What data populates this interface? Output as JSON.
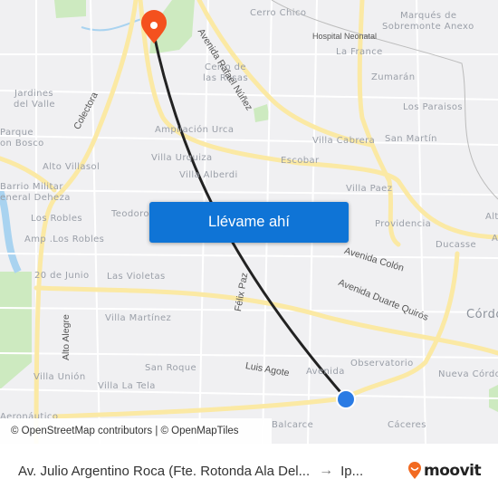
{
  "map": {
    "labels": {
      "cerro_chico": "Cerro Chico",
      "marques": "Marqués de",
      "sobremonte": "Sobremonte Anexo",
      "hospital": "Hospital Neonatal",
      "la_france": "La France",
      "zumaran": "Zumarán",
      "los_paraisos": "Los Paraisos",
      "san_martin": "San Martín",
      "villa_cabrera": "Villa Cabrera",
      "escobar": "Escobar",
      "villa_paez": "Villa Paez",
      "providencia": "Providencia",
      "ducasse": "Ducasse",
      "alta": "Alta",
      "a_partial": "A",
      "cordoba": "Córdo",
      "nueva_cordoba": "Nueva Córdo",
      "observatorio": "Observatorio",
      "avenida": "Avenida",
      "caceres": "Cáceres",
      "balcarce": "Balcarce",
      "cerro_rosas_1": "Cerro de",
      "cerro_rosas_2": "las Rosas",
      "ampliacion_urca": "Ampliación Urca",
      "villa_urquiza": "Villa Urquiza",
      "villa_alberdi": "Villa Alberdi",
      "jardines_1": "Jardines",
      "jardines_2": "del Valle",
      "parque_1": "Parque",
      "parque_2": "on Bosco",
      "alto_villasol": "Alto Villasol",
      "barrio_militar": "Barrio Militar",
      "general_deheza": "eneral Deheza",
      "los_robles": "Los Robles",
      "amp_los_robles": "Amp .Los Robles",
      "teodoro": "Teodoro",
      "veinte_junio": "20 de Junio",
      "las_violetas": "Las Violetas",
      "villa_martinez": "Villa Martínez",
      "villa_union": "Villa Unión",
      "villa_la_tela": "Villa La Tela",
      "san_roque": "San Roque",
      "aeronautico": "Aeronáutico"
    },
    "streets": {
      "rafael_nunez": "Avenida Rafael Núñez",
      "colectora": "Colectora",
      "felix_paz": "Félix Paz",
      "avenida_colon": "Avenida Colón",
      "duarte_quiros": "Avenida Duarte Quirós",
      "alto_alegre": "Alto Alegre",
      "luis_agote": "Luis Agote"
    },
    "destination_pin_color": "#f4511e",
    "origin_dot_color": "#2a7be4",
    "route_color": "#222222"
  },
  "cta": {
    "label": "Llévame ahí",
    "color": "#0f74d6"
  },
  "attribution": "© OpenStreetMap contributors | © OpenMapTiles",
  "footer": {
    "origin": "Av. Julio Argentino Roca (Fte. Rotonda Ala Del...",
    "arrow": "→",
    "destination": "Ip...",
    "brand": "moovit",
    "brand_color": "#f26a21"
  }
}
